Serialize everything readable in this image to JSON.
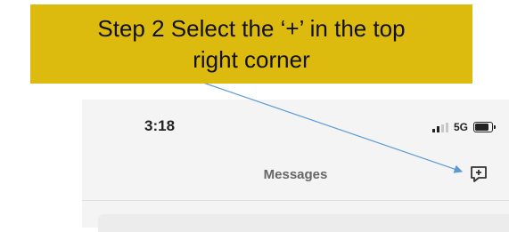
{
  "callout": {
    "line1": "Step 2 Select the ‘+’ in the top",
    "line2": "right corner"
  },
  "status_bar": {
    "time": "3:18",
    "network": "5G"
  },
  "header": {
    "title": "Messages",
    "compose_icon": "new-message-plus-icon"
  },
  "colors": {
    "callout_bg": "#dcba0e",
    "arrow": "#5b9bd5",
    "icon": "#333333"
  }
}
